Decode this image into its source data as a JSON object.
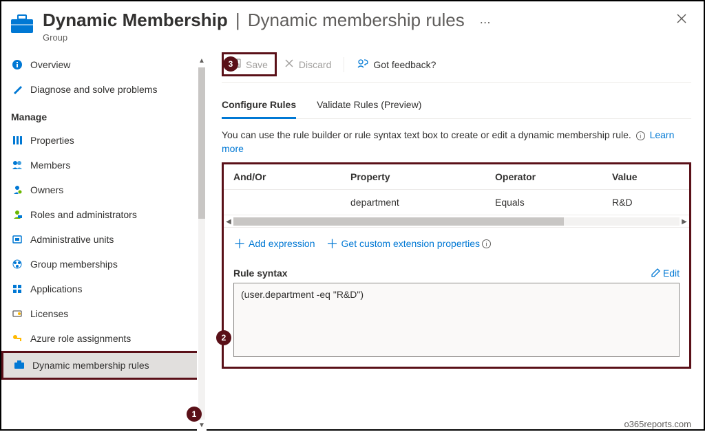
{
  "header": {
    "title": "Dynamic Membership",
    "separator": "|",
    "subtitle": "Dynamic membership rules",
    "ellipsis": "⋯",
    "subtype": "Group"
  },
  "sidebar": {
    "items_top": [
      {
        "label": "Overview",
        "icon": "info-icon"
      },
      {
        "label": "Diagnose and solve problems",
        "icon": "wrench-icon"
      }
    ],
    "section_heading": "Manage",
    "items_manage": [
      {
        "label": "Properties",
        "icon": "properties-icon"
      },
      {
        "label": "Members",
        "icon": "members-icon"
      },
      {
        "label": "Owners",
        "icon": "owners-icon"
      },
      {
        "label": "Roles and administrators",
        "icon": "admin-icon"
      },
      {
        "label": "Administrative units",
        "icon": "units-icon"
      },
      {
        "label": "Group memberships",
        "icon": "group-memberships-icon"
      },
      {
        "label": "Applications",
        "icon": "apps-icon"
      },
      {
        "label": "Licenses",
        "icon": "licenses-icon"
      },
      {
        "label": "Azure role assignments",
        "icon": "key-icon"
      },
      {
        "label": "Dynamic membership rules",
        "icon": "rules-icon",
        "selected": true
      }
    ]
  },
  "toolbar": {
    "save_label": "Save",
    "discard_label": "Discard",
    "feedback_label": "Got feedback?"
  },
  "tabs": {
    "configure": "Configure Rules",
    "validate": "Validate Rules (Preview)"
  },
  "help": {
    "text": "You can use the rule builder or rule syntax text box to create or edit a dynamic membership rule.",
    "learn_more": "Learn more"
  },
  "rules_table": {
    "headers": {
      "andor": "And/Or",
      "property": "Property",
      "operator": "Operator",
      "value": "Value"
    },
    "rows": [
      {
        "andor": "",
        "property": "department",
        "operator": "Equals",
        "value": "R&D"
      }
    ],
    "add_expression": "Add expression",
    "get_extension": "Get custom extension properties"
  },
  "syntax": {
    "label": "Rule syntax",
    "edit": "Edit",
    "value": "(user.department -eq \"R&D\")"
  },
  "callouts": {
    "one": "1",
    "two": "2",
    "three": "3"
  },
  "watermark": "o365reports.com"
}
